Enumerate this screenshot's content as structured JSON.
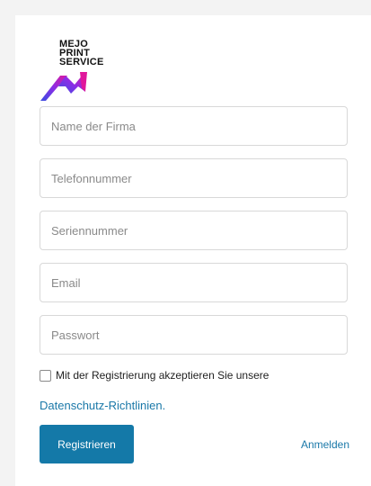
{
  "logo": {
    "lines": [
      "MEJO",
      "PRINT",
      "SERVICE"
    ],
    "colors": {
      "left": "#5a3ee8",
      "right": "#e0179b"
    }
  },
  "form": {
    "company_placeholder": "Name der Firma",
    "phone_placeholder": "Telefonnummer",
    "serial_placeholder": "Seriennummer",
    "email_placeholder": "Email",
    "password_placeholder": "Passwort",
    "consent_label": "Mit der Registrierung akzeptieren Sie unsere",
    "consent_checked": false,
    "privacy_link": "Datenschutz-Richtlinien.",
    "register_label": "Registrieren",
    "login_label": "Anmelden"
  },
  "colors": {
    "primary": "#1479a8",
    "link": "#1a78a8",
    "page_background": "#f3f3f3"
  }
}
